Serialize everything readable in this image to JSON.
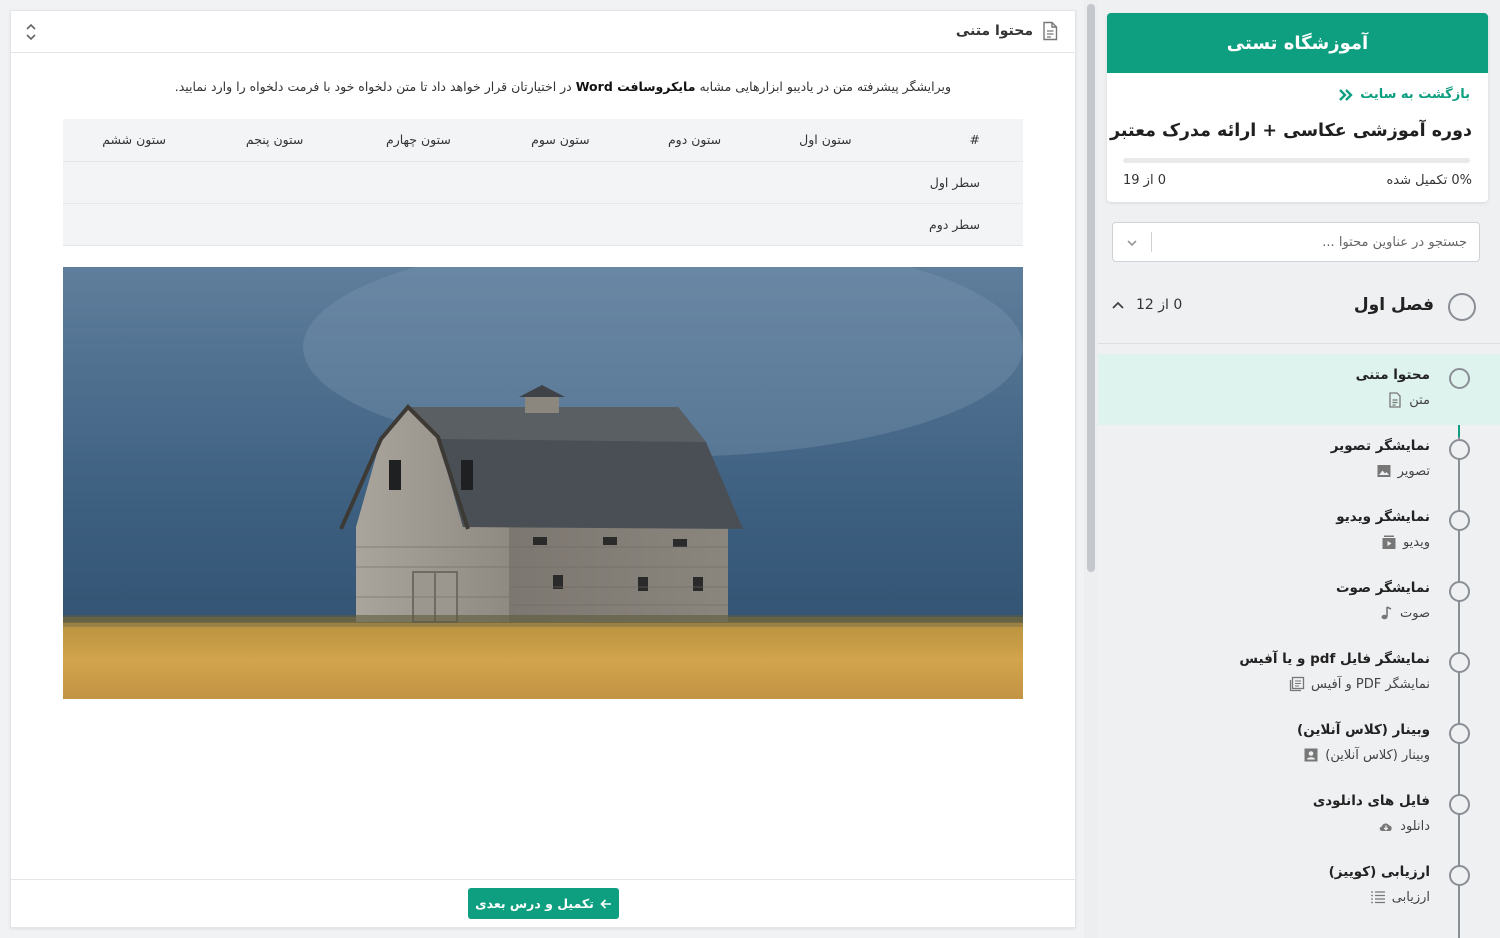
{
  "main": {
    "header_title": "محتوا متنی",
    "intro_part1": "ویرایشگر پیشرفته متن در یادیبو ابزارهایی مشابه ",
    "intro_bold": "مایکروسافت Word",
    "intro_part2": " در اختیارتان قرار خواهد داد تا متن دلخواه خود با فرمت دلخواه را وارد نمایید.",
    "table": {
      "headers": [
        "#",
        "ستون اول",
        "ستون دوم",
        "ستون سوم",
        "ستون چهارم",
        "ستون پنجم",
        "ستون ششم"
      ],
      "rows": [
        [
          "سطر اول",
          "",
          "",
          "",
          "",
          "",
          ""
        ],
        [
          "سطر دوم",
          "",
          "",
          "",
          "",
          "",
          ""
        ]
      ]
    },
    "next_button": "تکمیل و درس بعدی"
  },
  "sidebar": {
    "school_name": "آموزشگاه تستی",
    "back_link": "بازگشت به سایت",
    "course_title": "دوره آموزشی عکاسی + ارائه مدرک معتبر",
    "progress_percent": 0,
    "progress_text": "0% تکمیل شده",
    "progress_count": "0 از 19",
    "search_placeholder": "جستجو در عناوین محتوا ...",
    "chapter": {
      "title": "فصل اول",
      "count": "0 از 12"
    },
    "lessons": [
      {
        "title": "محتوا متنی",
        "type": "متن",
        "icon": "document-icon",
        "active": true
      },
      {
        "title": "نمایشگر تصویر",
        "type": "تصویر",
        "icon": "image-icon",
        "active": false
      },
      {
        "title": "نمایشگر ویدیو",
        "type": "ویدیو",
        "icon": "video-icon",
        "active": false
      },
      {
        "title": "نمایشگر صوت",
        "type": "صوت",
        "icon": "music-note-icon",
        "active": false
      },
      {
        "title": "نمایشگر فایل pdf و یا آفیس",
        "type": "نمایشگر PDF و آفیس",
        "icon": "pdf-viewer-icon",
        "active": false
      },
      {
        "title": "وبینار (کلاس آنلاین)",
        "type": "وبینار (کلاس آنلاین)",
        "icon": "webinar-icon",
        "active": false
      },
      {
        "title": "فایل های دانلودی",
        "type": "دانلود",
        "icon": "cloud-download-icon",
        "active": false
      },
      {
        "title": "ارزیابی (کوییز)",
        "type": "ارزیابی",
        "icon": "quiz-list-icon",
        "active": false
      }
    ]
  },
  "colors": {
    "accent": "#0e9f80",
    "active_lesson_bg": "#dff3ee"
  }
}
